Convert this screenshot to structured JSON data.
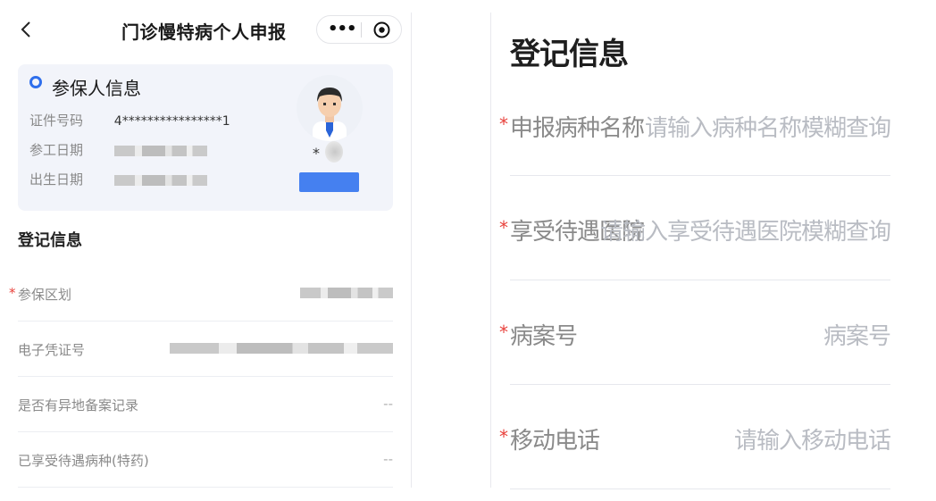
{
  "nav": {
    "title": "门诊慢特病个人申报",
    "more_icon": "more-icon",
    "close_icon": "target-icon"
  },
  "insured_card": {
    "title": "参保人信息",
    "rows": [
      {
        "label": "证件号码",
        "value": "4****************1"
      },
      {
        "label": "参工日期",
        "value": ""
      },
      {
        "label": "出生日期",
        "value": ""
      }
    ],
    "gender_mark": "*"
  },
  "left_form": {
    "section_title": "登记信息",
    "rows": [
      {
        "label": "参保区划",
        "value": "",
        "required": true
      },
      {
        "label": "电子凭证号",
        "value": "",
        "required": false
      },
      {
        "label": "是否有异地备案记录",
        "value": "--",
        "required": false
      },
      {
        "label": "已享受待遇病种(特药)",
        "value": "--",
        "required": false
      }
    ]
  },
  "right_form": {
    "section_title": "登记信息",
    "required_mark": "*",
    "rows": [
      {
        "label": "申报病种名称",
        "placeholder": "请输入病种名称模糊查询"
      },
      {
        "label": "享受待遇医院",
        "placeholder": "请输入享受待遇医院模糊查询"
      },
      {
        "label": "病案号",
        "placeholder": "病案号"
      },
      {
        "label": "移动电话",
        "placeholder": "请输入移动电话"
      }
    ]
  },
  "colors": {
    "accent": "#2f6fec",
    "required": "#e8413b",
    "card_bg": "#f2f4fa",
    "button": "#4580f0"
  }
}
